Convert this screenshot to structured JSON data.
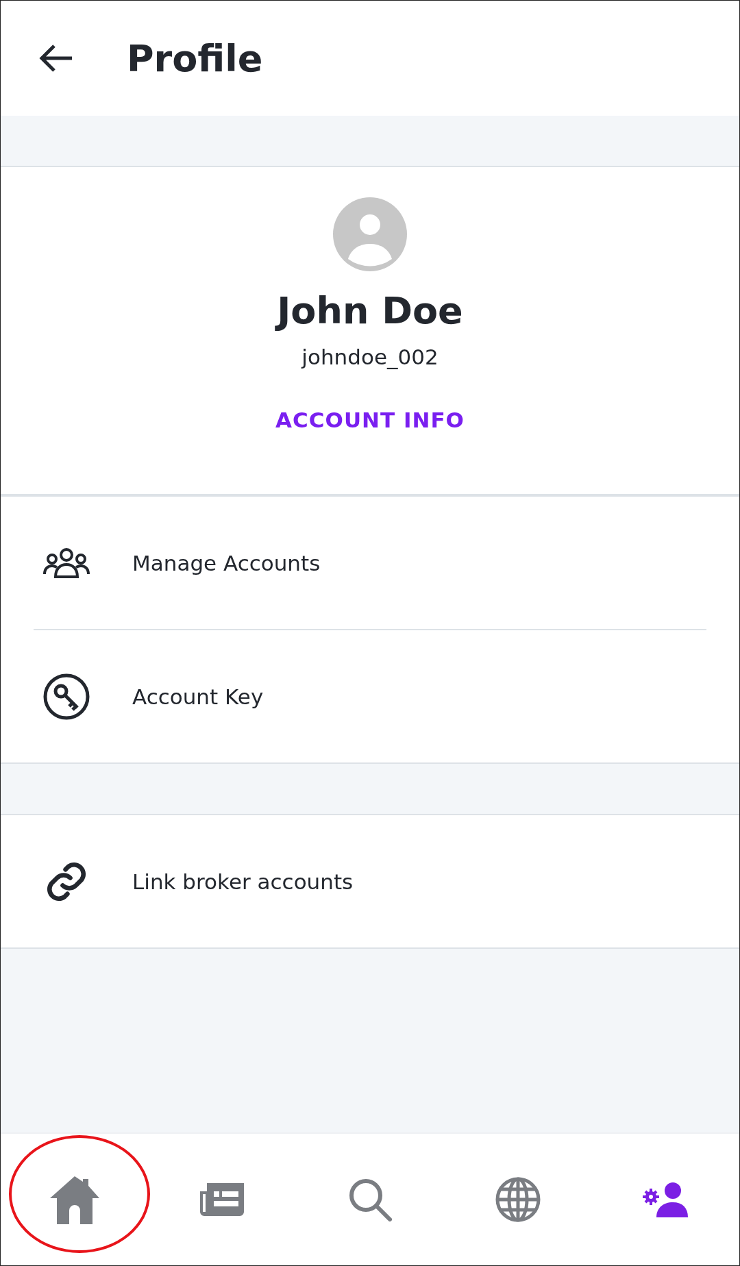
{
  "header": {
    "title": "Profile"
  },
  "profile": {
    "name": "John Doe",
    "username": "johndoe_002",
    "link": "ACCOUNT INFO"
  },
  "menu_groups": [
    {
      "items": [
        {
          "kind": "accounts",
          "label": "Manage Accounts"
        },
        {
          "kind": "key",
          "label": "Account Key"
        }
      ]
    },
    {
      "items": [
        {
          "kind": "link",
          "label": "Link broker accounts"
        }
      ]
    }
  ],
  "bottom_nav": [
    {
      "kind": "home",
      "selected": false,
      "highlighted": true
    },
    {
      "kind": "news",
      "selected": false,
      "highlighted": false
    },
    {
      "kind": "search",
      "selected": false,
      "highlighted": false
    },
    {
      "kind": "globe",
      "selected": false,
      "highlighted": false
    },
    {
      "kind": "profile",
      "selected": true,
      "highlighted": false
    }
  ]
}
